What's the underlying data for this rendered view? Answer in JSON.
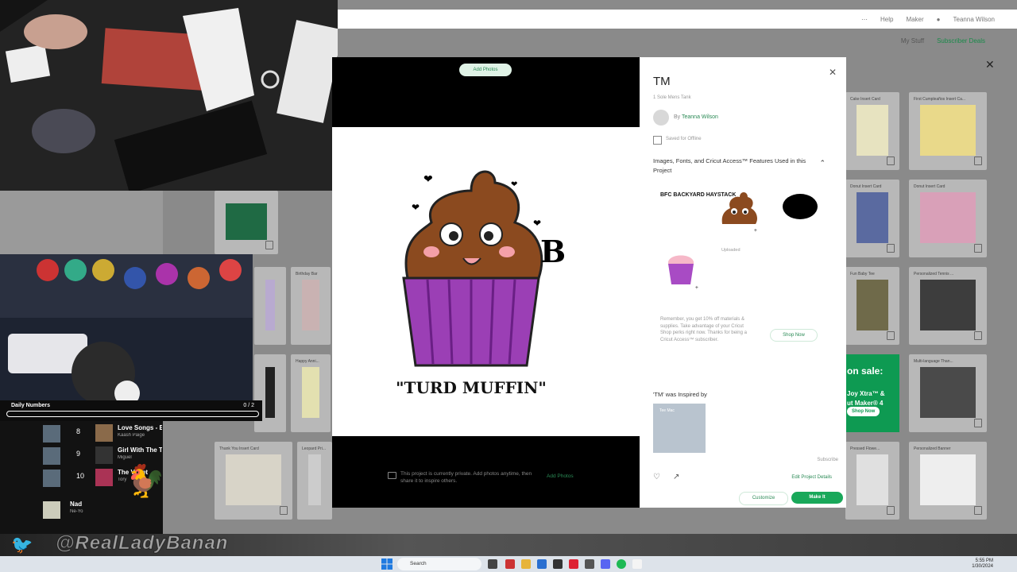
{
  "topbar": {
    "help": "Help",
    "maker": "Maker",
    "user": "Teanna Wilson"
  },
  "subbar": {
    "mystuff": "My Stuff",
    "subscribe": "Subscriber Deals"
  },
  "tiles": [
    {
      "label": "Cake Insert Card"
    },
    {
      "label": "First Cumpleaños Insert Ca..."
    },
    {
      "label": "Donut Insert Card"
    },
    {
      "label": "Donut Insert Card"
    },
    {
      "label": "Fun Baby Tee"
    },
    {
      "label": "Personalized Tennis ..."
    },
    {
      "label": "Birthday Bar"
    },
    {
      "label": "Happy Anni..."
    },
    {
      "label": "Multi-language Than..."
    },
    {
      "label": "Thank You Insert Card"
    },
    {
      "label": "Leopard Pri..."
    },
    {
      "label": "Pressed Flowe..."
    },
    {
      "label": "Personalized Banner"
    }
  ],
  "sale": {
    "head": "on sale:",
    "line1": "Joy Xtra™ &",
    "line2": "ut Maker® 4",
    "cta": "Shop Now"
  },
  "overlay": {
    "daily_title": "Daily Numbers",
    "daily_count": "0 / 2",
    "handle": "@RealLadyBanan",
    "playlist": [
      {
        "num": "8",
        "title": "Love Songs - Ba",
        "artist": "Kaash Paige"
      },
      {
        "num": "9",
        "title": "Girl With The Ta",
        "artist": "Miguel"
      },
      {
        "num": "10",
        "title": "The  Violet",
        "artist": "Tory"
      },
      {
        "num": "",
        "title": "Nad",
        "artist": "Ne-Yo"
      }
    ]
  },
  "modal": {
    "add_photos_top": "Add Photos",
    "title": "TM",
    "subtitle": "1 Sole Mens Tank",
    "by_prefix": "By",
    "author": "Teanna Wilson",
    "offline_label": "Saved for Offline",
    "features_heading": "Images, Fonts, and Cricut Access™ Features Used in this Project",
    "asset_text": "BFC BACKYARD HAYSTACK",
    "uploaded_label": "Uploaded",
    "promo": "Remember, you get 10% off materials & supplies. Take advantage of your Cricut Shop perks right now. Thanks for being a Cricut Access™ subscriber.",
    "shop_now": "Shop Now",
    "inspired_by": "'TM' was Inspired by",
    "inspired_thumb_label": "Tee Mac",
    "subscribe_label": "Subscribe",
    "edit_link": "Edit Project Details",
    "customize": "Customize",
    "make_it": "Make It",
    "private_note": "This project is currently private. Add photos anytime, then share it to inspire others.",
    "private_link": "Add Photos",
    "cupcake_caption": "\"TURD MUFFIN\""
  },
  "taskbar": {
    "search": "Search",
    "time": "5:55 PM",
    "date": "1/30/2024"
  },
  "colors": {
    "accent": "#19a85a",
    "poop": "#8b4a1f",
    "wrapper": "#9b3fb5"
  }
}
